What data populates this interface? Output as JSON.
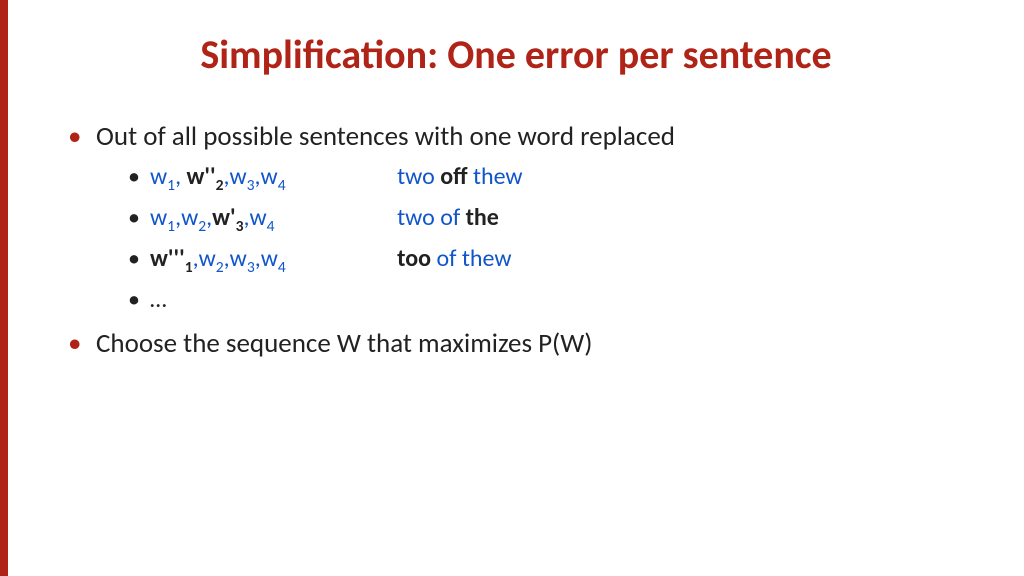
{
  "title": "Simplification: One error per sentence",
  "bullet1": "Out of all possible sentences with one word replaced",
  "examples": [
    {
      "seq": [
        {
          "w": "w",
          "sub": "1",
          "cls": "blue"
        },
        {
          "sep": ", ",
          "cls": "blue"
        },
        {
          "w": "w''",
          "sub": "2",
          "cls": "bold"
        },
        {
          "sep": ",",
          "cls": "blue"
        },
        {
          "w": "w",
          "sub": "3",
          "cls": "blue"
        },
        {
          "sep": ",",
          "cls": "blue"
        },
        {
          "w": "w",
          "sub": "4",
          "cls": "blue"
        }
      ],
      "phrase": [
        {
          "t": "two ",
          "cls": "blue"
        },
        {
          "t": "off ",
          "cls": "bold"
        },
        {
          "t": "thew",
          "cls": "blue"
        }
      ]
    },
    {
      "seq": [
        {
          "w": "w",
          "sub": "1",
          "cls": "blue"
        },
        {
          "sep": ",",
          "cls": "blue"
        },
        {
          "w": "w",
          "sub": "2",
          "cls": "blue"
        },
        {
          "sep": ",",
          "cls": "blue"
        },
        {
          "w": "w'",
          "sub": "3",
          "cls": "bold"
        },
        {
          "sep": ",",
          "cls": "blue"
        },
        {
          "w": "w",
          "sub": "4",
          "cls": "blue"
        }
      ],
      "phrase": [
        {
          "t": "two of ",
          "cls": "blue"
        },
        {
          "t": "the",
          "cls": "bold"
        }
      ]
    },
    {
      "seq": [
        {
          "w": "w'''",
          "sub": "1",
          "cls": "bold"
        },
        {
          "sep": ",",
          "cls": "blue"
        },
        {
          "w": "w",
          "sub": "2",
          "cls": "blue"
        },
        {
          "sep": ",",
          "cls": "blue"
        },
        {
          "w": "w",
          "sub": "3",
          "cls": "blue"
        },
        {
          "sep": ",",
          "cls": "blue"
        },
        {
          "w": "w",
          "sub": "4",
          "cls": "blue"
        }
      ],
      "phrase": [
        {
          "t": "too ",
          "cls": "bold"
        },
        {
          "t": "of thew",
          "cls": "blue"
        }
      ]
    }
  ],
  "ellipsis": "…",
  "bullet2": "Choose the sequence W that maximizes P(W)"
}
